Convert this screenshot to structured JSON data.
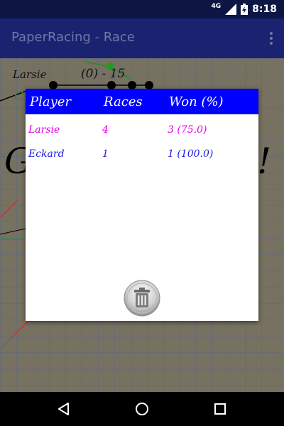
{
  "status_bar": {
    "network": "4G",
    "time": "8:18",
    "icons": [
      "signal-icon",
      "battery-icon"
    ]
  },
  "app_bar": {
    "title": "PaperRacing - Race",
    "menu_icon": "overflow-menu-icon"
  },
  "game": {
    "player_label": "Larsie",
    "score_text": "(0) - 15",
    "partial_letter": "C"
  },
  "stats_dialog": {
    "headers": {
      "player": "Player",
      "races": "Races",
      "won": "Won (%)"
    },
    "rows": [
      {
        "player": "Larsie",
        "races": "4",
        "won": "3 (75.0)",
        "color": "#e600e6"
      },
      {
        "player": "Eckard",
        "races": "1",
        "won": "1 (100.0)",
        "color": "#1a1ae6"
      }
    ],
    "delete_icon": "trash-icon",
    "header_color": "#0000ff"
  },
  "nav_bar": {
    "back": "back-icon",
    "home": "home-icon",
    "recents": "recents-icon"
  }
}
